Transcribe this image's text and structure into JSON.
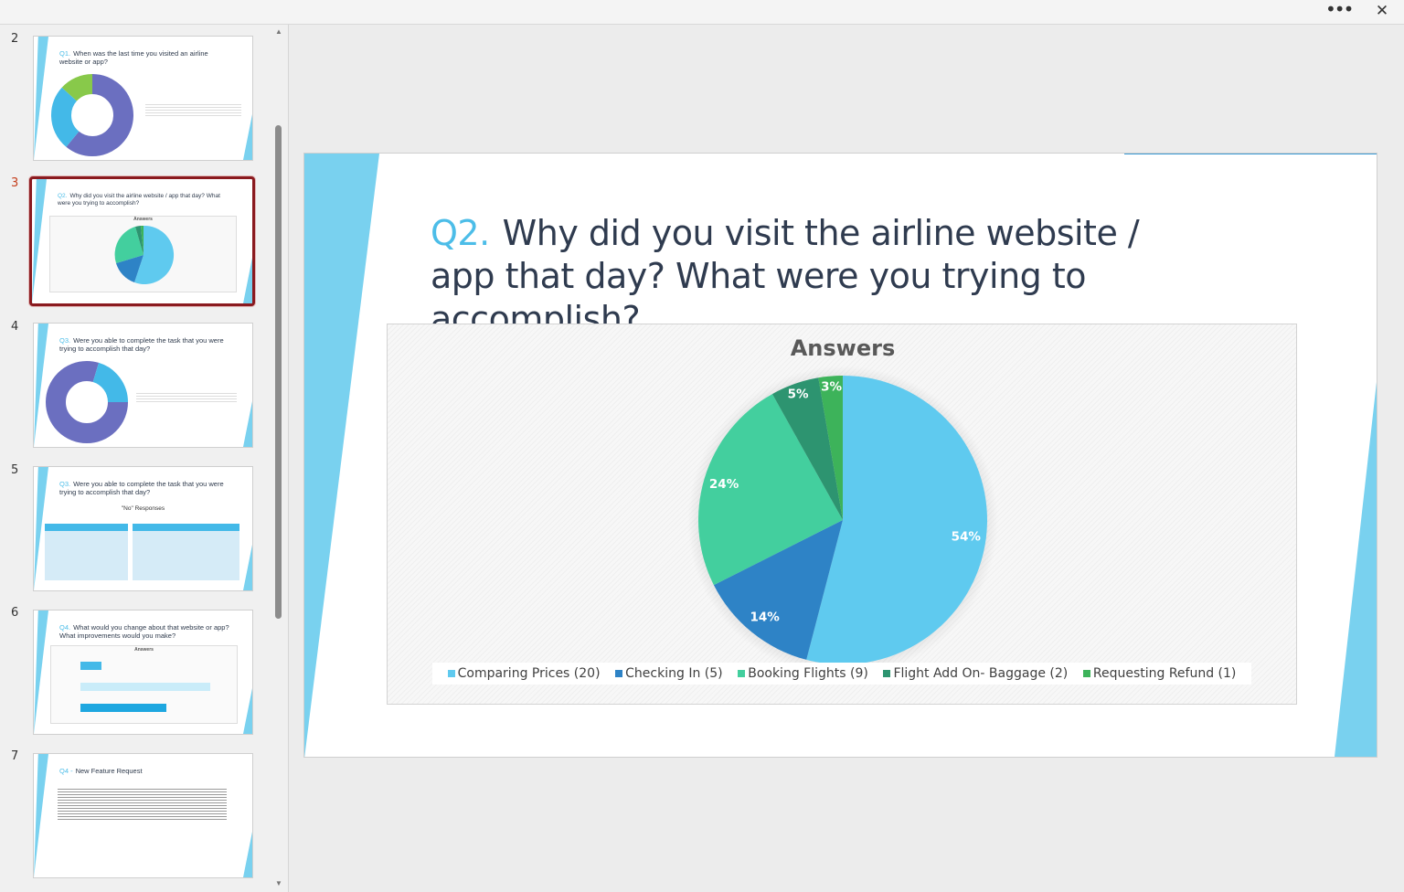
{
  "window": {
    "more_label": "•••",
    "close_label": "✕"
  },
  "thumbnails": [
    {
      "number": "2",
      "q": "Q1.",
      "title": "When was the last time you visited an airline website or app?"
    },
    {
      "number": "3",
      "q": "Q2.",
      "title": "Why did you visit the airline website / app that day? What were you trying to accomplish?",
      "chart_title": "Answers"
    },
    {
      "number": "4",
      "q": "Q3.",
      "title": "Were you able to complete the task that you were trying to accomplish that day?"
    },
    {
      "number": "5",
      "q": "Q3.",
      "title": "Were you able to complete the task that you were trying to accomplish that day?",
      "subtitle": "\"No\" Responses"
    },
    {
      "number": "6",
      "q": "Q4.",
      "title": "What would you change about that website or app? What improvements would you make?",
      "chart_title": "Answers"
    },
    {
      "number": "7",
      "q": "Q4 -",
      "title": "New Feature Request"
    }
  ],
  "slide": {
    "q": "Q2.",
    "title": "Why did you visit the airline website / app that day? What were you trying to accomplish?"
  },
  "chart_data": {
    "type": "pie",
    "title": "Answers",
    "categories": [
      "Comparing Prices",
      "Checking In",
      "Booking Flights",
      "Flight Add On- Baggage",
      "Requesting Refund"
    ],
    "values": [
      20,
      5,
      9,
      2,
      1
    ],
    "percent_labels": [
      "54%",
      "14%",
      "24%",
      "5%",
      "3%"
    ],
    "legend_labels": [
      "Comparing Prices (20)",
      "Checking In (5)",
      "Booking Flights (9)",
      "Flight Add On- Baggage (2)",
      "Requesting Refund (1)"
    ],
    "colors": [
      "#5fcaef",
      "#2e83c6",
      "#43cf9e",
      "#2d9470",
      "#3db35a"
    ],
    "legend_position": "bottom"
  }
}
